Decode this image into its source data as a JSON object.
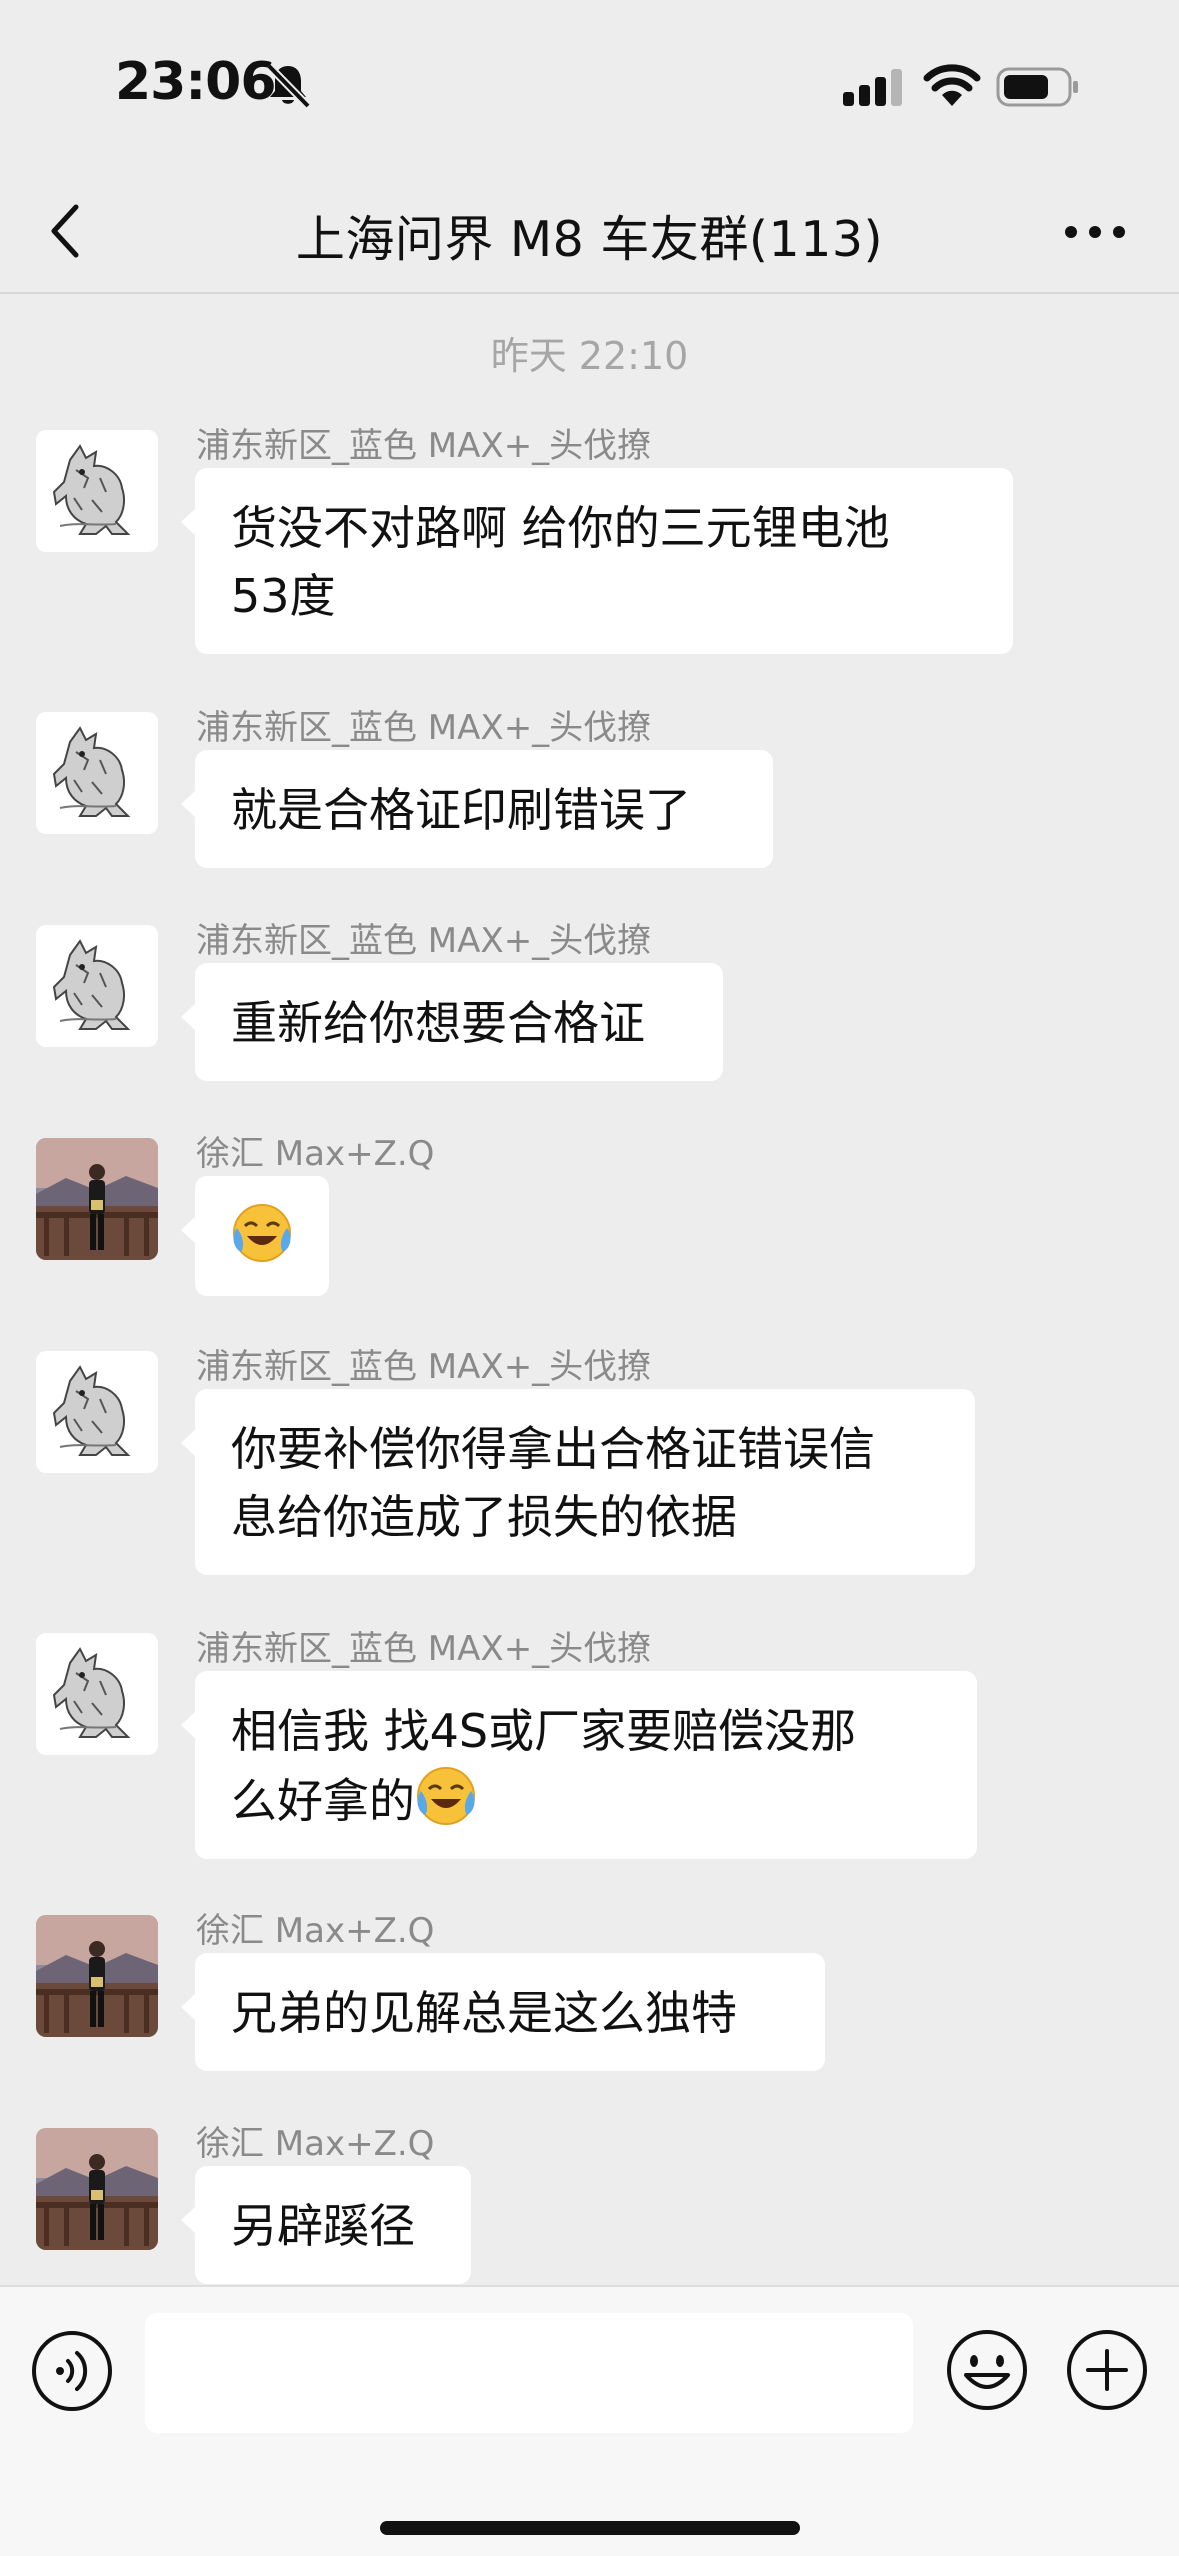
{
  "status_bar": {
    "time": "23:06"
  },
  "nav": {
    "title": "上海问界 M8 车友群(113)"
  },
  "chat": {
    "timestamp": "昨天 22:10",
    "messages": [
      {
        "sender": "浦东新区_蓝色 MAX+_头伐撩",
        "lines": [
          "货没不对路啊  给你的三元锂电池",
          "53度"
        ]
      },
      {
        "sender": "浦东新区_蓝色 MAX+_头伐撩",
        "lines": [
          "就是合格证印刷错误了"
        ]
      },
      {
        "sender": "浦东新区_蓝色 MAX+_头伐撩",
        "lines": [
          "重新给你想要合格证"
        ]
      },
      {
        "sender": "徐汇 Max+Z.Q",
        "emoji": "crying-laughing-emoji"
      },
      {
        "sender": "浦东新区_蓝色 MAX+_头伐撩",
        "lines": [
          "你要补偿你得拿出合格证错误信",
          "息给你造成了损失的依据"
        ]
      },
      {
        "sender": "浦东新区_蓝色 MAX+_头伐撩",
        "lines": [
          "相信我  找4S或厂家要赔偿没那",
          "么好拿的"
        ]
      },
      {
        "sender": "徐汇 Max+Z.Q",
        "lines": [
          "兄弟的见解总是这么独特"
        ]
      },
      {
        "sender": "徐汇 Max+Z.Q",
        "lines": [
          "另辟蹊径"
        ]
      }
    ]
  },
  "input": {
    "value": ""
  },
  "colors": {
    "background": "#ededed",
    "bubble": "#ffffff",
    "sender": "#8a8a8a",
    "timestamp": "#a6a6a6"
  }
}
